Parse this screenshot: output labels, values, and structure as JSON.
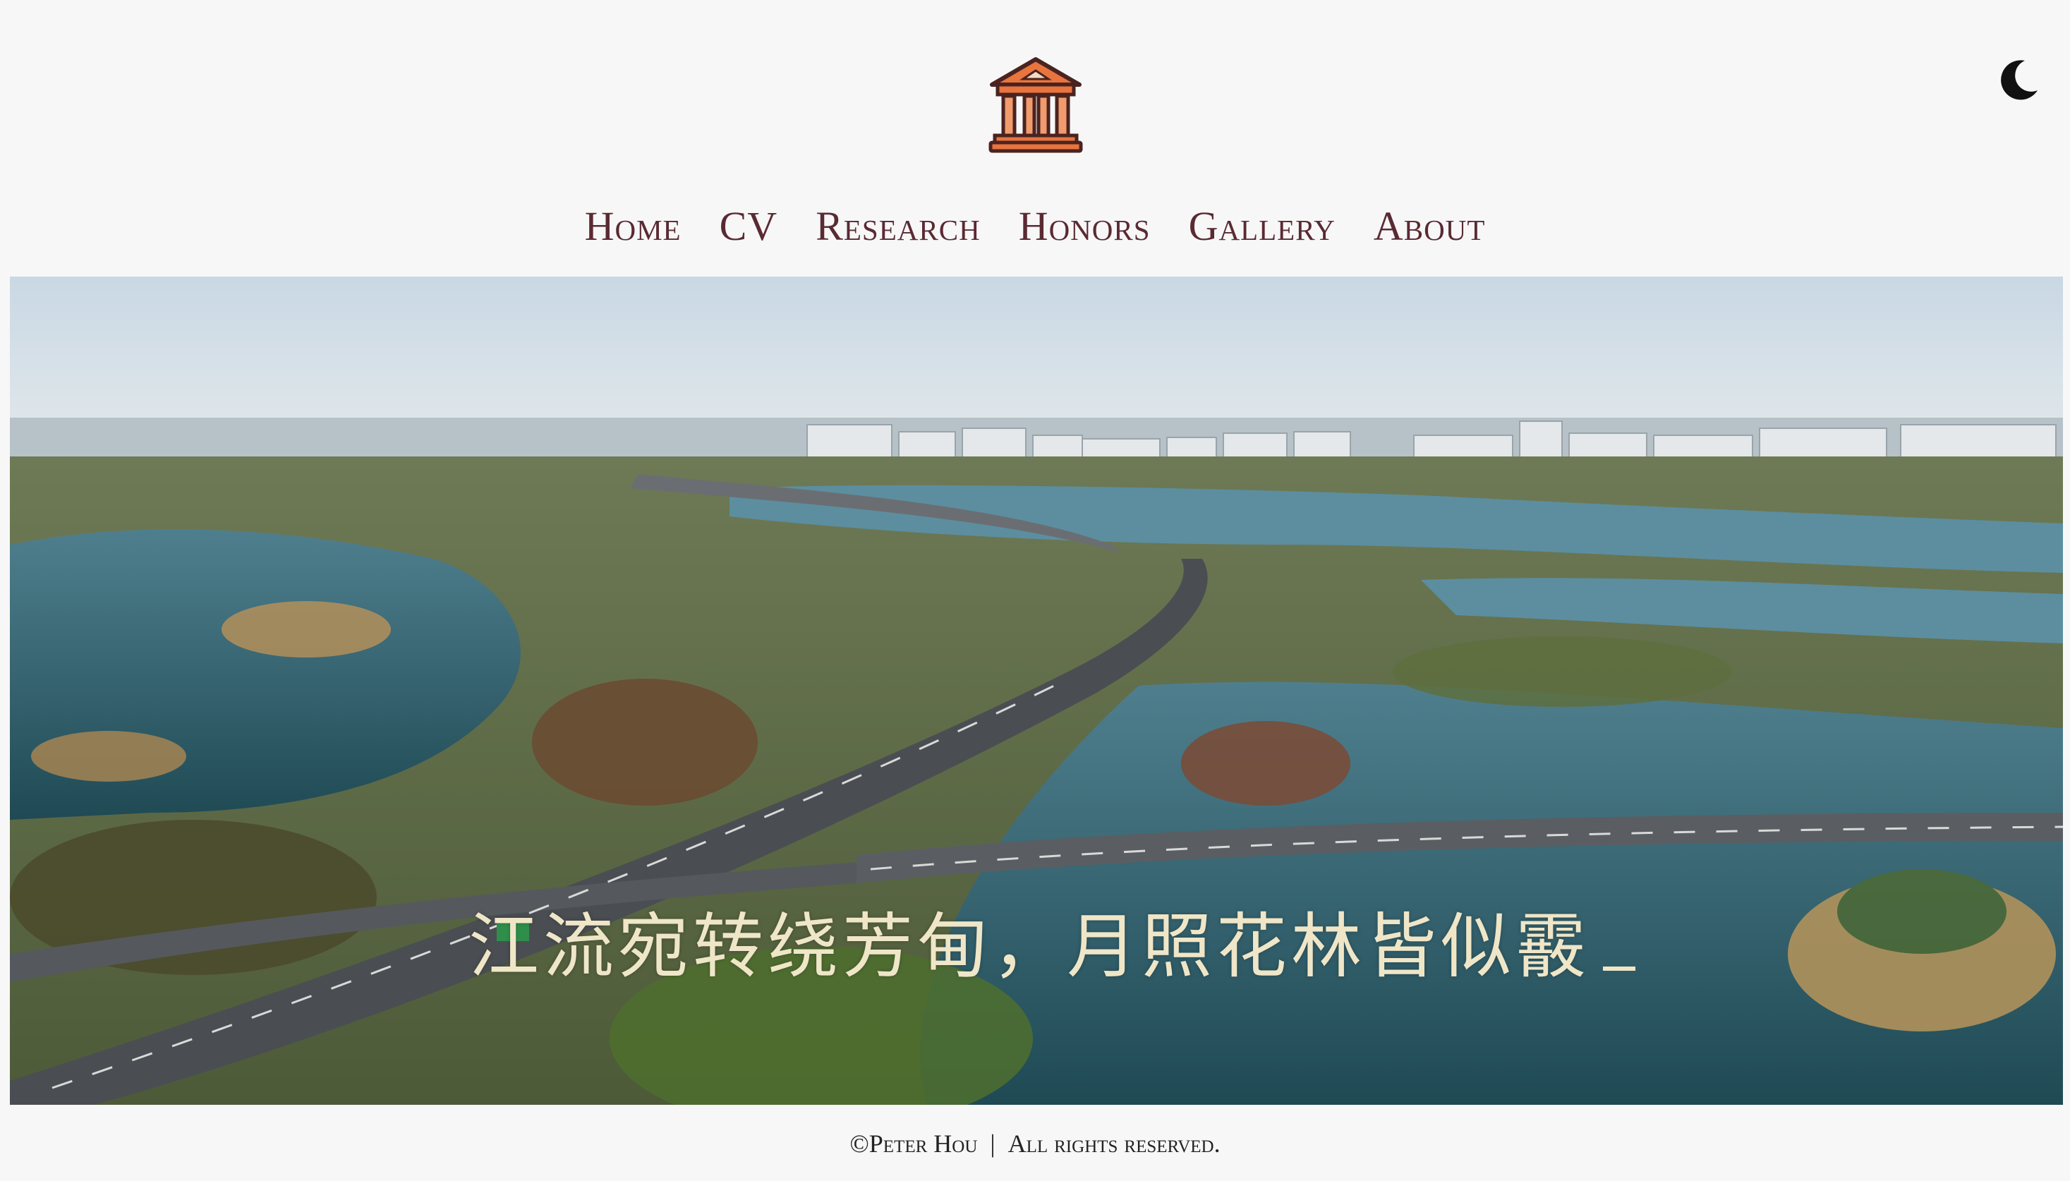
{
  "header": {
    "logo_icon": "museum-temple-icon",
    "theme_toggle_icon": "moon-icon",
    "colors": {
      "logo_orange": "#e8743e",
      "logo_outline": "#4a2320",
      "nav_text": "#5a2a33"
    }
  },
  "nav": {
    "items": [
      {
        "label": "Home"
      },
      {
        "label": "CV"
      },
      {
        "label": "Research"
      },
      {
        "label": "Honors"
      },
      {
        "label": "Gallery"
      },
      {
        "label": "About"
      }
    ]
  },
  "hero": {
    "image_subject": "aerial-landscape-photo",
    "poem": "江流宛转绕芳甸，月照花林皆似霰"
  },
  "footer": {
    "copyright": "©Peter Hou",
    "separator": "|",
    "rights": "All rights reserved."
  }
}
